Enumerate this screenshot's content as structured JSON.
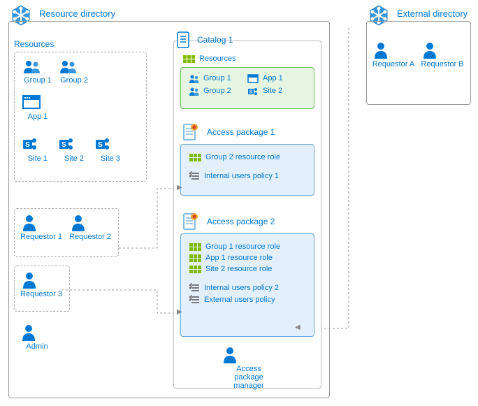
{
  "resourceDirectory": {
    "title": "Resource directory",
    "resourcesLabel": "Resources",
    "resources": {
      "group1": "Group 1",
      "group2": "Group 2",
      "app1": "App 1",
      "site1": "Site 1",
      "site2": "Site 2",
      "site3": "Site 3"
    },
    "internalRequestors": {
      "r1": "Requestor 1",
      "r2": "Requestor 2",
      "r3": "Requestor 3"
    },
    "admin": "Admin"
  },
  "catalog": {
    "title": "Catalog 1",
    "resourcesLabel": "Resources",
    "resources": {
      "group1": "Group 1",
      "group2": "Group 2",
      "app1": "App 1",
      "site2": "Site 2"
    },
    "package1": {
      "title": "Access package 1",
      "role1": "Group 2 resource role",
      "policy1": "Internal users policy 1"
    },
    "package2": {
      "title": "Access package 2",
      "role1": "Group 1 resource role",
      "role2": "App 1 resource role",
      "role3": "Site 2 resource role",
      "policy1": "Internal users policy 2",
      "policy2": "External users policy"
    },
    "manager": "Access package\nmanager"
  },
  "externalDirectory": {
    "title": "External directory",
    "requestorA": "Requestor A",
    "requestorB": "Requestor B"
  }
}
